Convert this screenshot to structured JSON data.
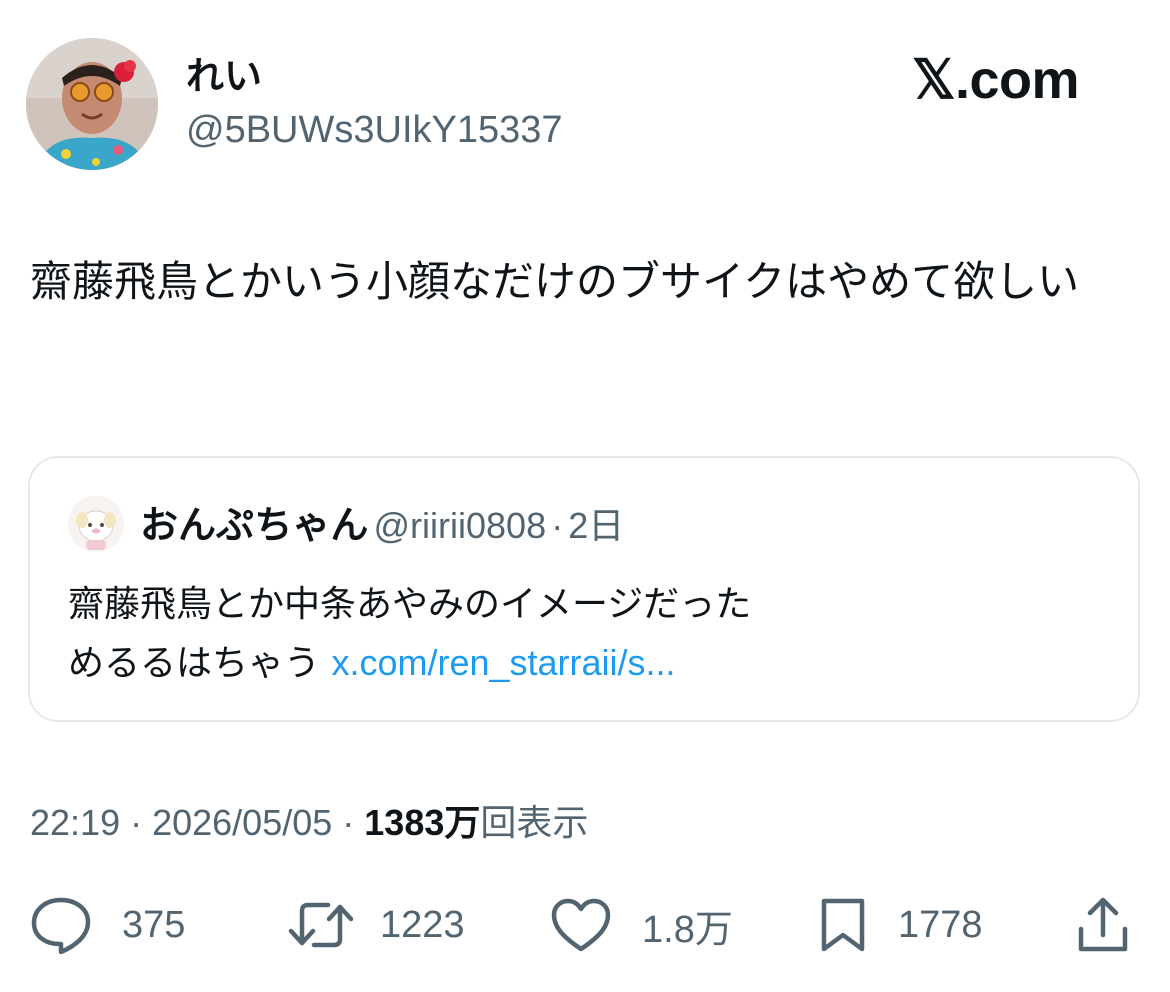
{
  "author": {
    "display_name": "れい",
    "handle": "@5BUWs3UIkY15337",
    "avatar_icon": "profile-photo-avatar"
  },
  "brand": {
    "label": "𝕏.com"
  },
  "tweet": {
    "text": "齋藤飛鳥とかいう小顔なだけのブサイクはやめて欲しい"
  },
  "quote": {
    "avatar_icon": "character-avatar",
    "display_name": "おんぷちゃん",
    "handle": "@riirii0808",
    "separator": "·",
    "time": "2日",
    "text": "齋藤飛鳥とか中条あやみのイメージだった\nめるるはちゃう",
    "link": "x.com/ren_starraii/s..."
  },
  "meta": {
    "time": "22:19",
    "sep1": " · ",
    "date": "2026/05/05",
    "sep2": " · ",
    "views_count": "1383万",
    "views_label": "回表示"
  },
  "actions": {
    "replies": "375",
    "retweets": "1223",
    "likes": "1.8万",
    "bookmarks": "1778",
    "share": ""
  },
  "colors": {
    "text": "#0f1419",
    "secondary": "#536471",
    "link": "#1d9bf0",
    "border": "#e4e9ed"
  }
}
